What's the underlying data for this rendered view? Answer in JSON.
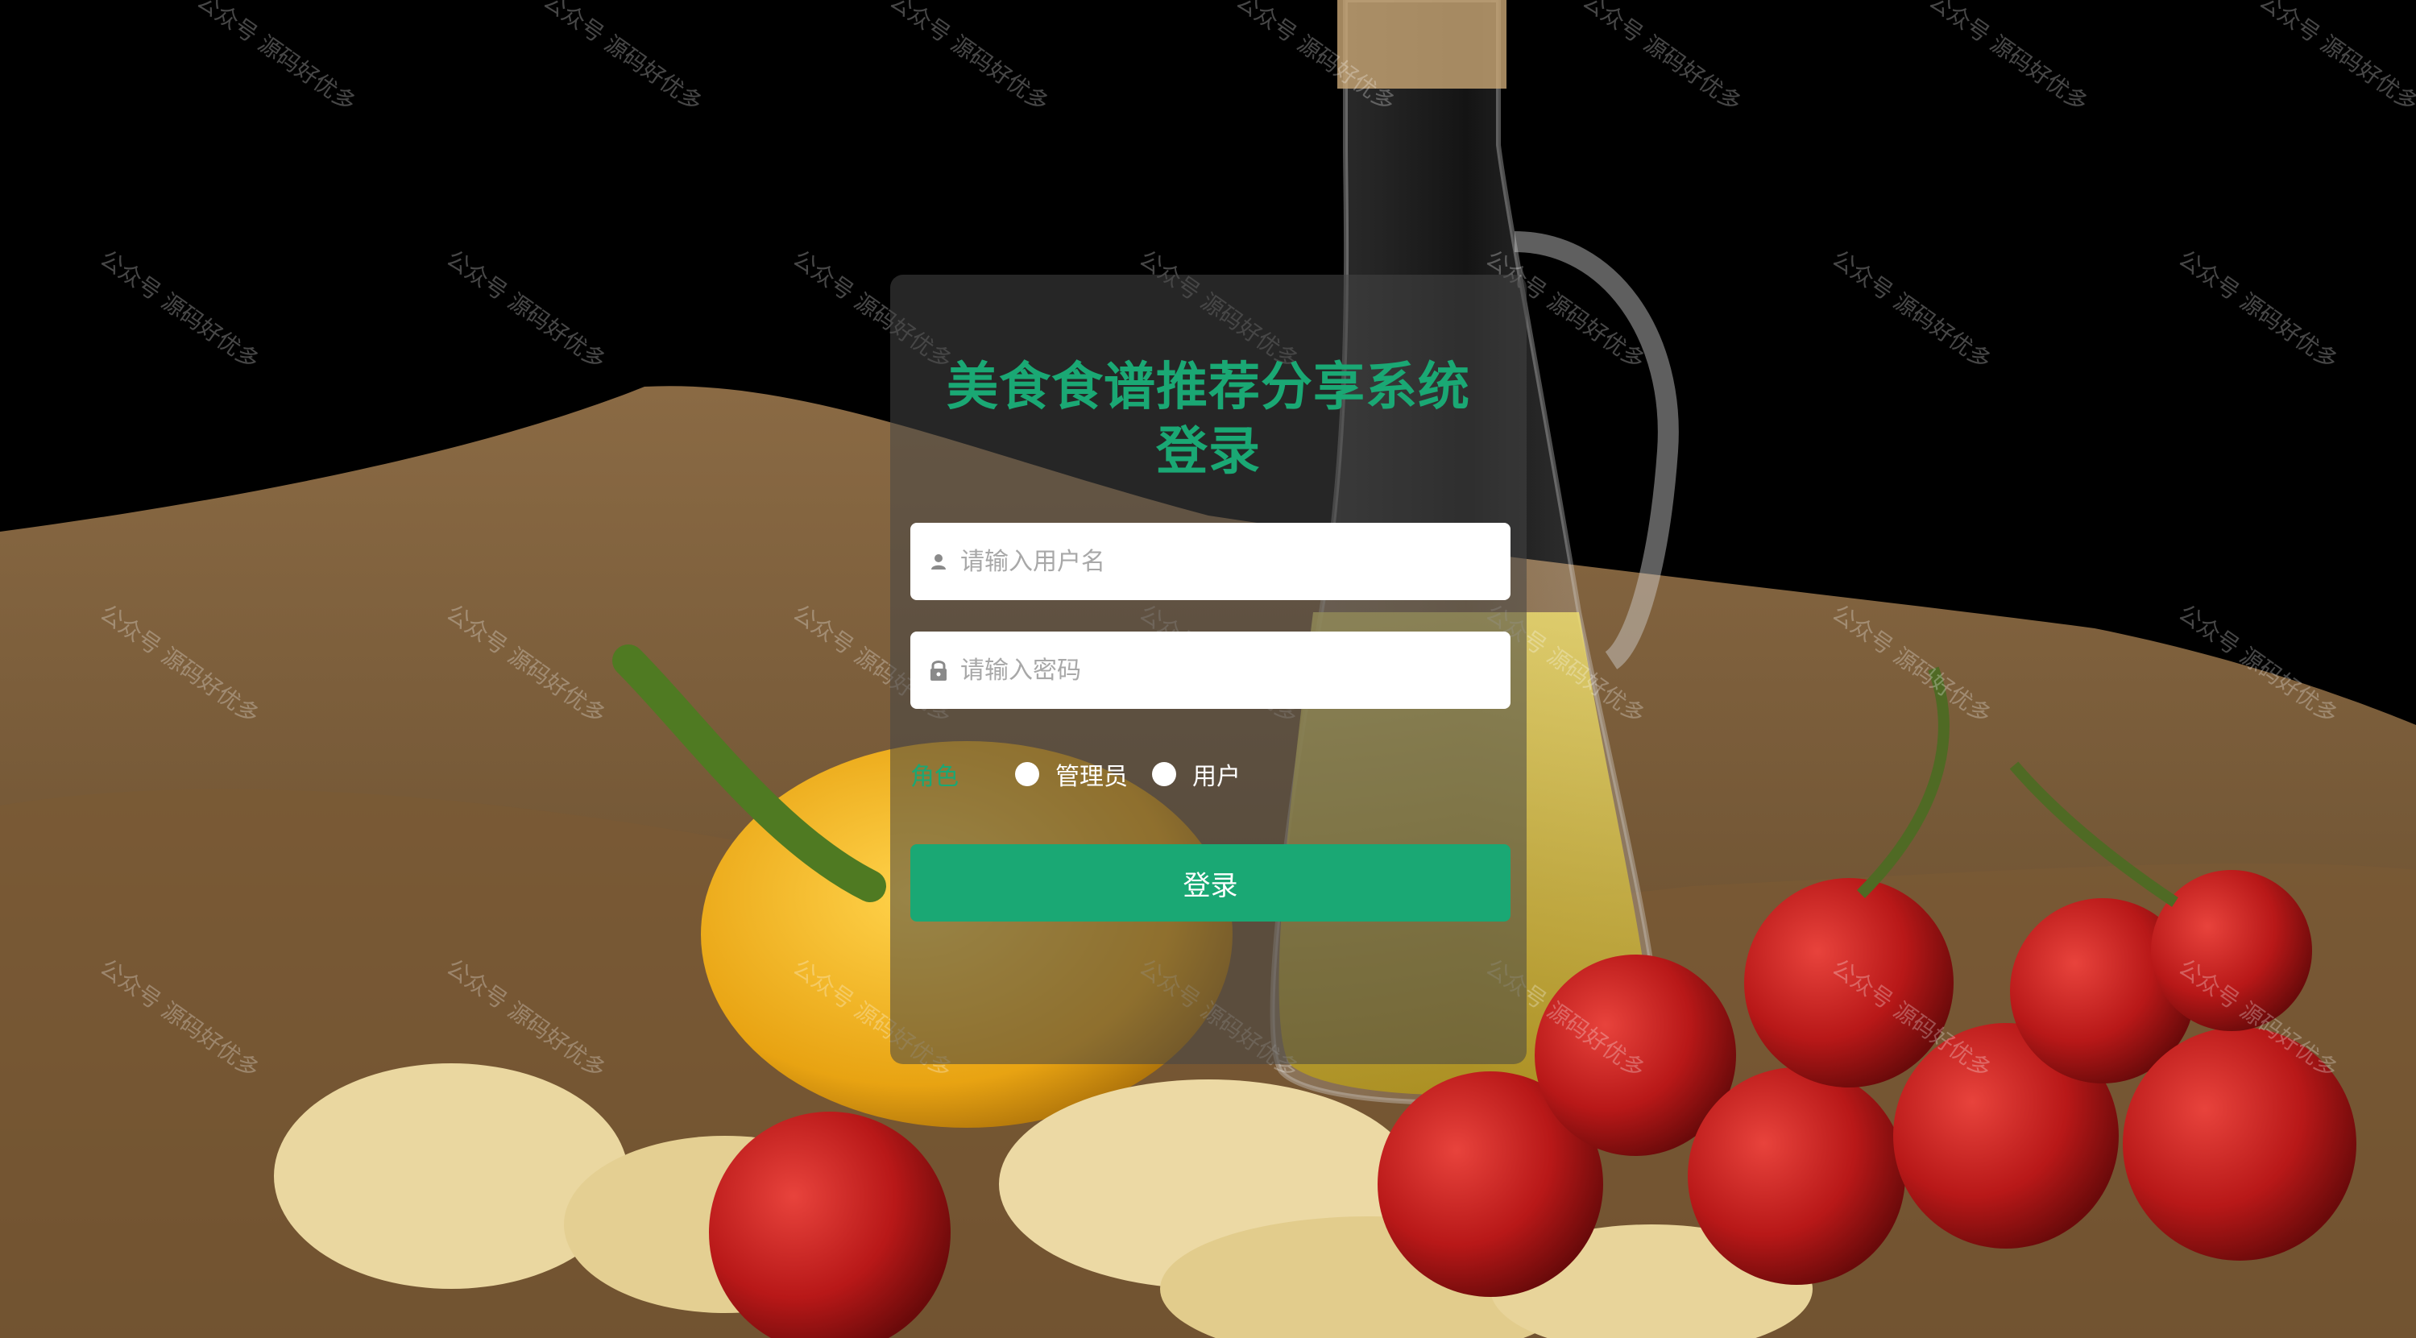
{
  "login": {
    "title": "美食食谱推荐分享系统登录",
    "username_placeholder": "请输入用户名",
    "password_placeholder": "请输入密码",
    "role_label": "角色",
    "roles": [
      "管理员",
      "用户"
    ],
    "submit_label": "登录"
  },
  "watermark_text": "公众号 源码好优多",
  "colors": {
    "accent": "#1aa874",
    "card_bg": "rgba(70,70,70,0.55)"
  }
}
